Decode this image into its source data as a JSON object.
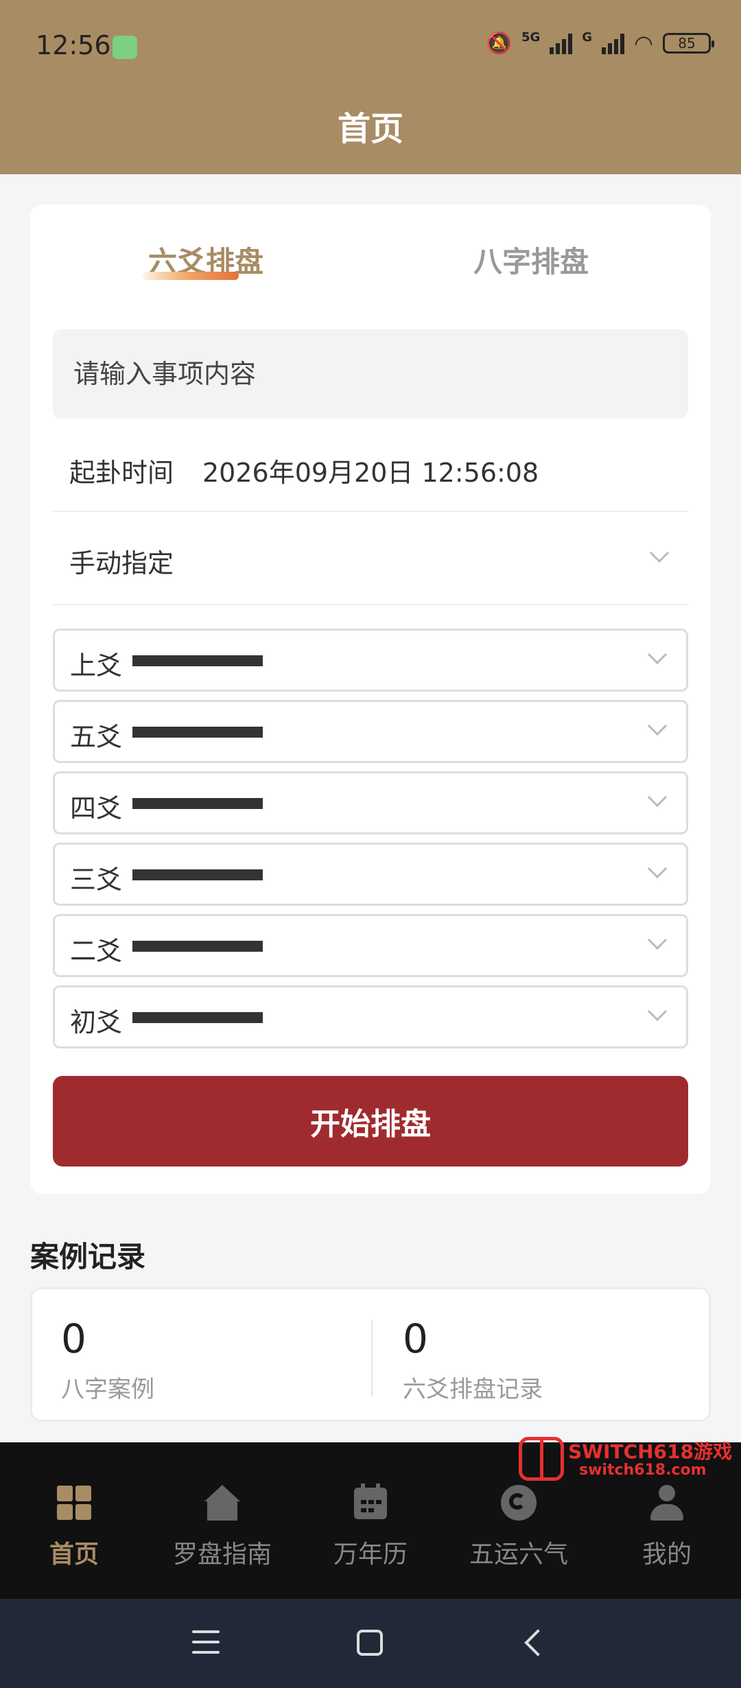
{
  "status_bar": {
    "time": "12:56",
    "network": "5G",
    "network2": "G",
    "battery": "85"
  },
  "header": {
    "title": "首页"
  },
  "tabs": [
    {
      "label": "六爻排盘",
      "active": true
    },
    {
      "label": "八字排盘",
      "active": false
    }
  ],
  "form": {
    "matter_placeholder": "请输入事项内容",
    "time_label": "起卦时间",
    "time_value": "2026年09月20日 12:56:08",
    "mode_label": "手动指定",
    "yao": [
      {
        "label": "上爻",
        "line": "solid"
      },
      {
        "label": "五爻",
        "line": "solid"
      },
      {
        "label": "四爻",
        "line": "solid"
      },
      {
        "label": "三爻",
        "line": "solid"
      },
      {
        "label": "二爻",
        "line": "solid"
      },
      {
        "label": "初爻",
        "line": "solid"
      }
    ],
    "start_button": "开始排盘"
  },
  "records": {
    "title": "案例记录",
    "items": [
      {
        "count": "0",
        "label": "八字案例"
      },
      {
        "count": "0",
        "label": "六爻排盘记录"
      }
    ]
  },
  "bottom_nav": [
    {
      "label": "首页",
      "icon": "grid-icon",
      "active": true
    },
    {
      "label": "罗盘指南",
      "icon": "house-icon",
      "active": false
    },
    {
      "label": "万年历",
      "icon": "calendar-icon",
      "active": false
    },
    {
      "label": "五运六气",
      "icon": "cycle-icon",
      "active": false
    },
    {
      "label": "我的",
      "icon": "user-icon",
      "active": false
    }
  ],
  "watermark": {
    "line1": "SWITCH618游戏",
    "line2": "switch618.com"
  },
  "colors": {
    "accent": "#a88c64",
    "primary_button": "#a02b2e",
    "nav_bg": "#111111",
    "system_nav_bg": "#212939"
  }
}
